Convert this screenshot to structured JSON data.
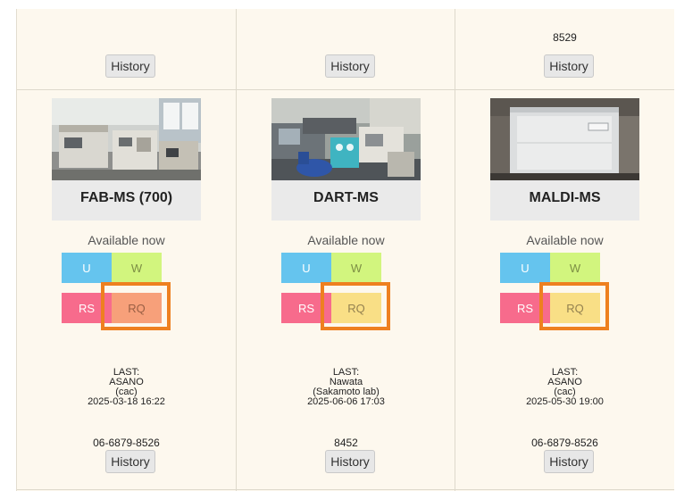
{
  "top_row": [
    {
      "phone": "",
      "history_label": "History"
    },
    {
      "phone": "",
      "history_label": "History"
    },
    {
      "phone": "8529",
      "history_label": "History"
    }
  ],
  "instruments": [
    {
      "name": "FAB-MS (700)",
      "status": "Available now",
      "buttons": {
        "u": "U",
        "w": "W",
        "rs": "RS",
        "rq": "RQ"
      },
      "rq_color": "#f7a07a",
      "last": {
        "label": "LAST:",
        "user": "ASANO",
        "group": "(cac)",
        "time": "2025-03-18 16:22"
      },
      "phone": "06-6879-8526",
      "history_label": "History"
    },
    {
      "name": "DART-MS",
      "status": "Available now",
      "buttons": {
        "u": "U",
        "w": "W",
        "rs": "RS",
        "rq": "RQ"
      },
      "rq_color": "#f9df86",
      "last": {
        "label": "LAST:",
        "user": "Nawata",
        "group": "(Sakamoto lab)",
        "time": "2025-06-06 17:03"
      },
      "phone": "8452",
      "history_label": "History"
    },
    {
      "name": "MALDI-MS",
      "status": "Available now",
      "buttons": {
        "u": "U",
        "w": "W",
        "rs": "RS",
        "rq": "RQ"
      },
      "rq_color": "#f9df86",
      "last": {
        "label": "LAST:",
        "user": "ASANO",
        "group": "(cac)",
        "time": "2025-05-30 19:00"
      },
      "phone": "06-6879-8526",
      "history_label": "History"
    }
  ],
  "colors": {
    "highlight": "#ee8020",
    "u": "#65c4ee",
    "w": "#d2f57e",
    "rs": "#f76b8c",
    "panel_bg": "#fdf8ee"
  }
}
